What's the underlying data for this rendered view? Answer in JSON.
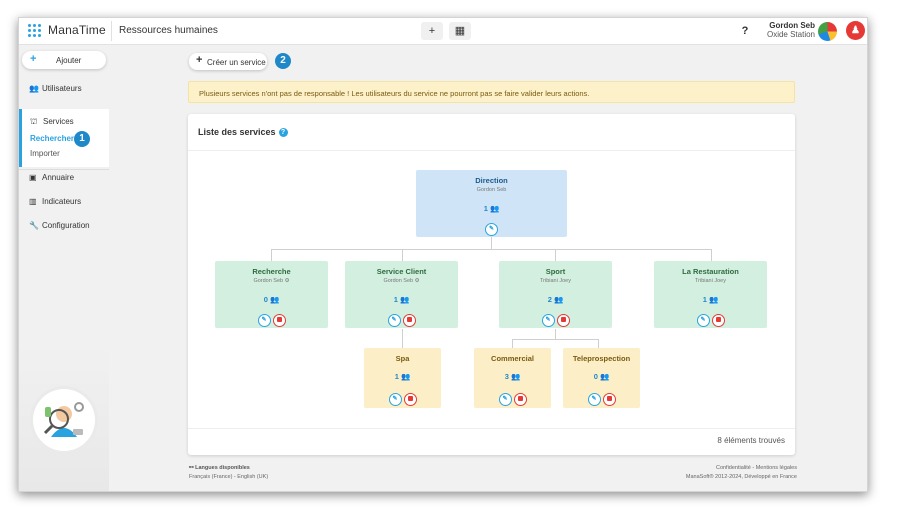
{
  "app": {
    "logo": "ManaTime",
    "page_heading": "Ressources humaines"
  },
  "topbar": {
    "add_symbol": "+",
    "calendar_symbol": "▦",
    "help_symbol": "?",
    "user_name": "Gordon Seb",
    "user_org": "Oxide Station",
    "notif_symbol": "♟"
  },
  "sidebar": {
    "add_label": "Ajouter",
    "users_label": "Utilisateurs",
    "services_label": "Services",
    "search_label": "Rechercher",
    "import_label": "Importer",
    "directory_label": "Annuaire",
    "indicators_label": "Indicateurs",
    "config_label": "Configuration",
    "bubble_1": "1"
  },
  "main": {
    "create_label": "Créer un service",
    "bubble_2": "2",
    "warning": "Plusieurs services n'ont pas de responsable ! Les utilisateurs du service ne pourront pas se faire valider leurs actions.",
    "card_title": "Liste des services",
    "help_icon": "?",
    "count": "8 éléments trouvés"
  },
  "services": {
    "direction": {
      "name": "Direction",
      "manager": "Gordon Seb",
      "count": "1 👥"
    },
    "recherche": {
      "name": "Recherche",
      "manager": "Gordon Seb ⚙",
      "count": "0 👥"
    },
    "service_client": {
      "name": "Service Client",
      "manager": "Gordon Seb ⚙",
      "count": "1 👥"
    },
    "sport": {
      "name": "Sport",
      "manager": "Tribiani Joey",
      "count": "2 👥"
    },
    "restauration": {
      "name": "La Restauration",
      "manager": "Tribiani Joey",
      "count": "1 👥"
    },
    "spa": {
      "name": "Spa",
      "count": "1 👥"
    },
    "commercial": {
      "name": "Commercial",
      "count": "3 👥"
    },
    "teleprospection": {
      "name": "Teleprospection",
      "count": "0 👥"
    }
  },
  "footer": {
    "languages_title": "⚯ Langues disponibles",
    "languages": "Français (France) - English (UK)",
    "legal": "Confidentialité - Mentions légales",
    "copyright": "ManaSoft® 2012-2024, Développé en France"
  },
  "colors": {
    "accent": "#29a3e0",
    "danger": "#e53935",
    "warning_bg": "#fcf1c8"
  },
  "icons": [
    "grid-icon",
    "users-icon",
    "org-chart-icon",
    "book-icon",
    "chart-icon",
    "wrench-icon",
    "edit-icon",
    "trash-icon",
    "help-icon"
  ]
}
